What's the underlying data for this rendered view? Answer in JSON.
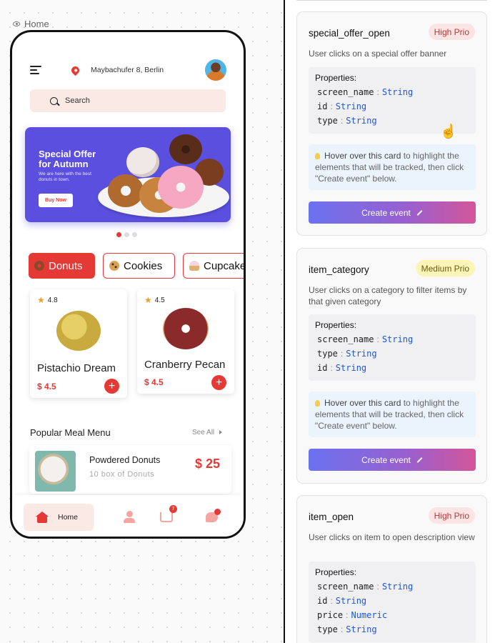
{
  "breadcrumb": {
    "label": "Home"
  },
  "app": {
    "address": "Maybachufer 8, Berlin",
    "search_placeholder": "Search",
    "banner": {
      "title_line1": "Special Offer",
      "title_line2": "for Autumn",
      "subtitle": "We are here with the best donuts in town.",
      "button": "Buy Now"
    },
    "carousel": {
      "count": 3,
      "active": 1
    },
    "categories": [
      {
        "label": "Donuts",
        "active": true
      },
      {
        "label": "Cookies",
        "active": false
      },
      {
        "label": "Cupcake",
        "active": false
      }
    ],
    "products": [
      {
        "rating": "4.8",
        "name": "Pistachio Dream",
        "price": "$ 4.5"
      },
      {
        "rating": "4.5",
        "name": "Cranberry Pecan",
        "price": "$ 4.5"
      }
    ],
    "popular": {
      "title": "Popular Meal Menu",
      "see_all": "See All",
      "item": {
        "name": "Powdered Donuts",
        "subtitle": "10 box of Donuts",
        "price": "$ 25"
      }
    },
    "tabbar": {
      "home_label": "Home",
      "cart_badge": "7"
    },
    "colors": {
      "accent": "#e53935",
      "banner": "#5b4fe0",
      "chip_bg": "#fbe9e6"
    }
  },
  "events": [
    {
      "name": "special_offer_open",
      "priority": "High Prio",
      "description": "User clicks on a special offer banner",
      "properties_label": "Properties:",
      "properties": [
        {
          "key": "screen_name",
          "type": "String"
        },
        {
          "key": "id",
          "type": "String"
        },
        {
          "key": "type",
          "type": "String"
        }
      ],
      "hint_bold": "Hover over this card",
      "hint_rest": " to highlight the elements that will be tracked, then click \"Create event\" below.",
      "button": "Create event"
    },
    {
      "name": "item_category",
      "priority": "Medium Prio",
      "description": "User clicks on a category to filter items by that given category",
      "properties_label": "Properties:",
      "properties": [
        {
          "key": "screen_name",
          "type": "String"
        },
        {
          "key": "type",
          "type": "String"
        },
        {
          "key": "id",
          "type": "String"
        }
      ],
      "hint_bold": "Hover over this card",
      "hint_rest": " to highlight the elements that will be tracked, then click \"Create event\" below.",
      "button": "Create event"
    },
    {
      "name": "item_open",
      "priority": "High Prio",
      "description": "User clicks on item to open description view",
      "properties_label": "Properties:",
      "properties": [
        {
          "key": "screen_name",
          "type": "String"
        },
        {
          "key": "id",
          "type": "String"
        },
        {
          "key": "price",
          "type": "Numeric"
        },
        {
          "key": "type",
          "type": "String"
        }
      ]
    }
  ]
}
